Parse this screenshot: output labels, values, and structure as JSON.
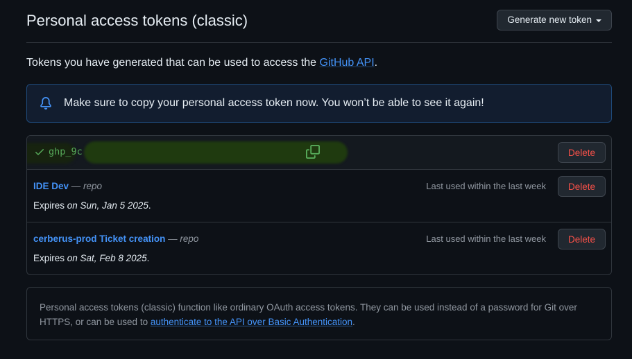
{
  "header": {
    "title": "Personal access tokens (classic)",
    "generate_button": "Generate new token"
  },
  "intro": {
    "text": "Tokens you have generated that can be used to access the ",
    "link": "GitHub API",
    "suffix": "."
  },
  "notice": {
    "icon": "bell-icon",
    "text": "Make sure to copy your personal access token now. You won’t be able to see it again!"
  },
  "new_token": {
    "value_prefix": "ghp_9c",
    "delete_label": "Delete"
  },
  "tokens": [
    {
      "name": "IDE Dev",
      "separator": " — ",
      "scope": "repo",
      "expires_label": "Expires ",
      "expires_date": "on Sun, Jan 5 2025",
      "expires_suffix": ".",
      "last_used": "Last used within the last week",
      "delete_label": "Delete"
    },
    {
      "name": "cerberus-prod Ticket creation",
      "separator": " — ",
      "scope": "repo",
      "expires_label": "Expires ",
      "expires_date": "on Sat, Feb 8 2025",
      "expires_suffix": ".",
      "last_used": "Last used within the last week",
      "delete_label": "Delete"
    }
  ],
  "info": {
    "text": "Personal access tokens (classic) function like ordinary OAuth access tokens. They can be used instead of a password for Git over HTTPS, or can be used to ",
    "link": "authenticate to the API over Basic Authentication",
    "suffix": "."
  },
  "colors": {
    "background": "#0d1117",
    "link": "#4493f8",
    "danger": "#f85149",
    "success": "#57ab5a",
    "border": "#30363d"
  }
}
